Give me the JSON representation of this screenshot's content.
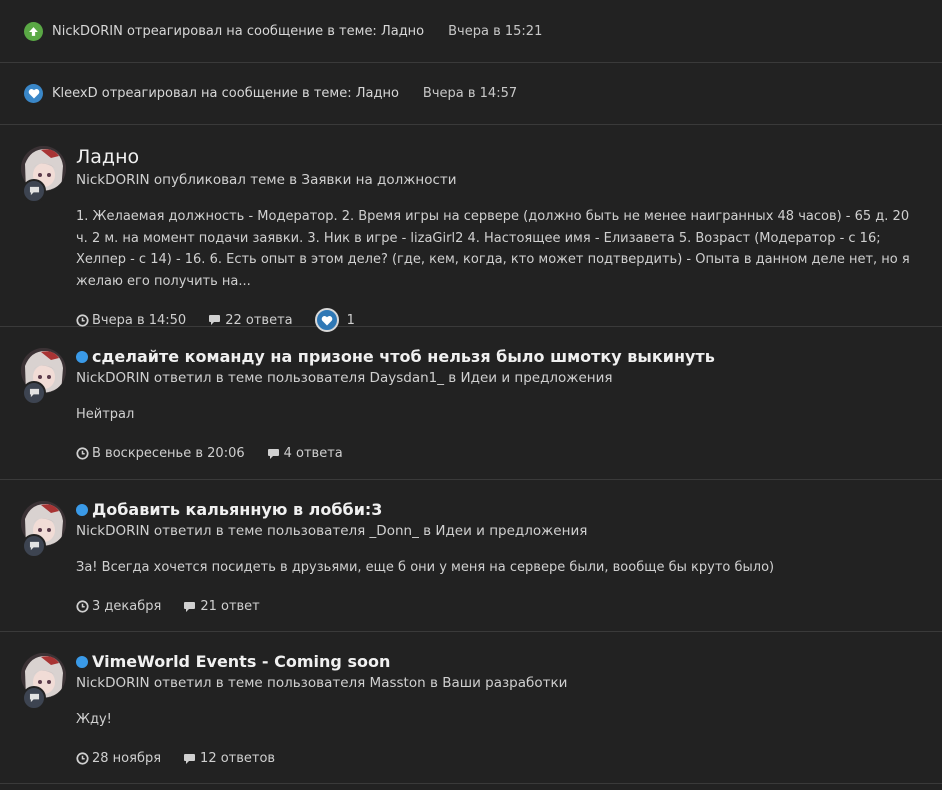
{
  "notifications": [
    {
      "icon": "upvote-icon",
      "text": "NickDORIN отреагировал на сообщение в теме: Ладно",
      "time": "Вчера в 15:21"
    },
    {
      "icon": "heart-icon",
      "text": "KleexD отреагировал на сообщение в теме: Ладно",
      "time": "Вчера в 14:57"
    }
  ],
  "posts": [
    {
      "title": "Ладно",
      "unread": false,
      "meta": "NickDORIN опубликовал теме в Заявки на должности",
      "snippet": "1. Желаемая должность - Модератор. 2. Время игры на сервере (должно быть не менее наигранных 48 часов) - 65 д. 20 ч. 2 м. на момент подачи заявки. 3. Ник в игре - lizaGirl2 4. Настоящее имя - Елизавета 5. Возраст (Модератор - с 16; Хелпер - с 14) - 16. 6. Есть опыт в этом деле? (где, кем, когда, кто может подтвердить) - Опыта в данном деле нет, но я желаю его получить на...",
      "time": "Вчера в 14:50",
      "replies": "22 ответа",
      "reactions": "1"
    },
    {
      "title": "сделайте команду на призоне чтоб нельзя было шмотку выкинуть",
      "unread": true,
      "meta": "NickDORIN ответил в теме пользователя Daysdan1_ в Идеи и предложения",
      "snippet": "Нейтрал",
      "time": "В воскресенье в 20:06",
      "replies": "4 ответа"
    },
    {
      "title": "Добавить кальянную в лобби:3",
      "unread": true,
      "meta": "NickDORIN ответил в теме пользователя _Donn_ в Идеи и предложения",
      "snippet": "За! Всегда хочется посидеть в друзьями, еще б они у меня на сервере были, вообще бы круто было)",
      "time": "3 декабря",
      "replies": "21 ответ"
    },
    {
      "title": "VimeWorld Events - Coming soon",
      "unread": true,
      "meta": "NickDORIN ответил в теме пользователя Masston в Ваши разработки",
      "snippet": "Жду!",
      "time": "28 ноября",
      "replies": "12 ответов"
    }
  ],
  "colors": {
    "background": "#222222",
    "unread": "#3a9ae8",
    "upvote": "#5aa845",
    "heart": "#3a87c8"
  }
}
